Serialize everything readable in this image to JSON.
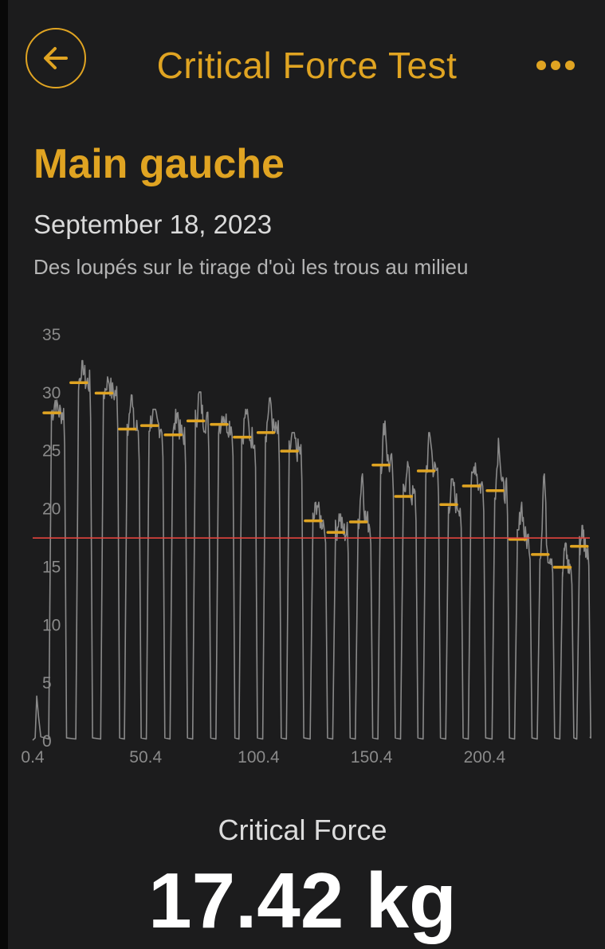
{
  "header": {
    "title": "Critical Force Test",
    "back_icon": "arrow-left-icon",
    "more_icon": "ellipsis-icon"
  },
  "session": {
    "hand": "Main gauche",
    "date": "September 18, 2023",
    "note": "Des loupés sur le tirage d'où les trous au milieu"
  },
  "colors": {
    "accent": "#e0a422",
    "background": "#1c1c1d",
    "force_trace": "#8a8a8a",
    "critical_line": "#e2443e"
  },
  "chart_data": {
    "type": "line",
    "title": "",
    "xlabel": "",
    "ylabel": "",
    "x_ticks": [
      "0.4",
      "50.4",
      "100.4",
      "150.4",
      "200.4"
    ],
    "x_tick_values": [
      0.4,
      50.4,
      100.4,
      150.4,
      200.4
    ],
    "y_ticks": [
      "0",
      "5",
      "10",
      "15",
      "20",
      "25",
      "30",
      "35"
    ],
    "y_tick_values": [
      0,
      5,
      10,
      15,
      20,
      25,
      30,
      35
    ],
    "xlim": [
      0.4,
      247
    ],
    "ylim": [
      0,
      35
    ],
    "grid": false,
    "critical_force": 17.42,
    "reps": [
      {
        "start": 7.8,
        "end": 15.0,
        "peak": 29.3,
        "avg": 28.2
      },
      {
        "start": 19.8,
        "end": 26.5,
        "peak": 32.7,
        "avg": 30.8
      },
      {
        "start": 30.8,
        "end": 38.5,
        "peak": 31.3,
        "avg": 29.9
      },
      {
        "start": 41.3,
        "end": 48.0,
        "peak": 30.0,
        "avg": 26.8
      },
      {
        "start": 51.0,
        "end": 58.5,
        "peak": 28.5,
        "avg": 27.1
      },
      {
        "start": 61.5,
        "end": 68.5,
        "peak": 28.5,
        "avg": 26.3
      },
      {
        "start": 71.5,
        "end": 78.8,
        "peak": 30.0,
        "avg": 27.5
      },
      {
        "start": 81.8,
        "end": 89.5,
        "peak": 28.2,
        "avg": 27.2
      },
      {
        "start": 92.0,
        "end": 99.5,
        "peak": 28.5,
        "avg": 26.1
      },
      {
        "start": 102.5,
        "end": 110.0,
        "peak": 29.5,
        "avg": 26.5
      },
      {
        "start": 113.0,
        "end": 120.0,
        "peak": 26.5,
        "avg": 24.9
      },
      {
        "start": 123.5,
        "end": 130.5,
        "peak": 20.5,
        "avg": 18.9
      },
      {
        "start": 133.5,
        "end": 140.5,
        "peak": 19.5,
        "avg": 17.9
      },
      {
        "start": 143.5,
        "end": 150.5,
        "peak": 23.0,
        "avg": 18.8
      },
      {
        "start": 153.5,
        "end": 160.5,
        "peak": 27.5,
        "avg": 23.7
      },
      {
        "start": 163.5,
        "end": 170.5,
        "peak": 24.0,
        "avg": 21.0
      },
      {
        "start": 173.5,
        "end": 180.5,
        "peak": 26.5,
        "avg": 23.2
      },
      {
        "start": 183.5,
        "end": 190.5,
        "peak": 22.5,
        "avg": 20.3
      },
      {
        "start": 193.5,
        "end": 200.5,
        "peak": 24.0,
        "avg": 21.9
      },
      {
        "start": 204.0,
        "end": 211.0,
        "peak": 26.0,
        "avg": 21.5
      },
      {
        "start": 214.0,
        "end": 221.0,
        "peak": 20.5,
        "avg": 17.3
      },
      {
        "start": 224.0,
        "end": 231.0,
        "peak": 23.0,
        "avg": 16.0
      },
      {
        "start": 234.0,
        "end": 239.5,
        "peak": 17.0,
        "avg": 14.9
      },
      {
        "start": 241.5,
        "end": 247.0,
        "peak": 18.5,
        "avg": 16.7
      }
    ]
  },
  "result": {
    "label": "Critical Force",
    "value": "17.42 kg"
  }
}
